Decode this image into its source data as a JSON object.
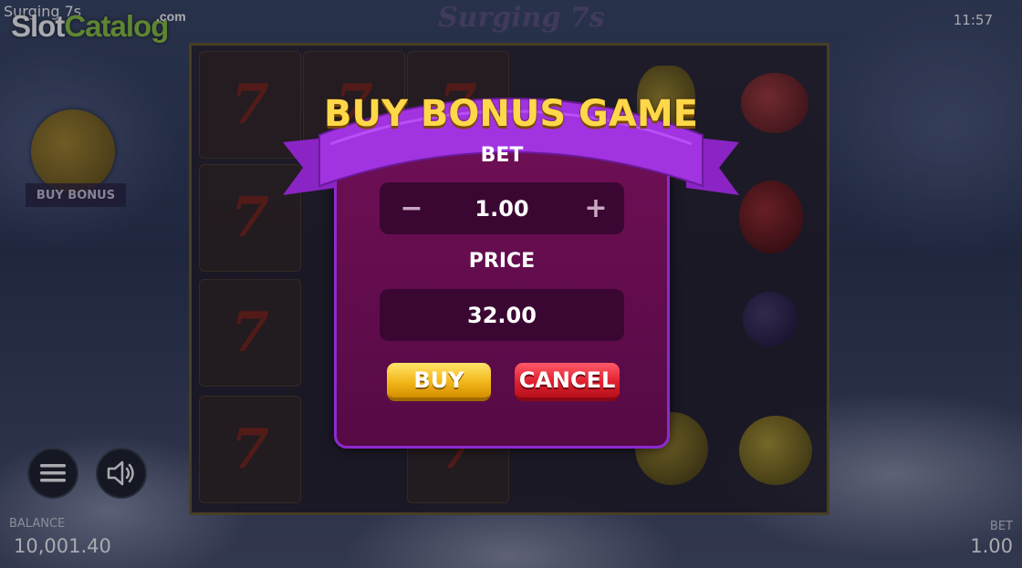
{
  "header": {
    "game_title": "Surging 7s",
    "clock": "11:57",
    "logo_part1": "Slot",
    "logo_part2": "Catalog",
    "logo_suffix": ".com",
    "background_title": "Surging 7s"
  },
  "side": {
    "buy_bonus_label": "BUY BONUS"
  },
  "reels": {
    "symbols": [
      "7",
      "7",
      "7",
      "7",
      "7",
      "7",
      "7"
    ]
  },
  "modal": {
    "title": "BUY BONUS GAME",
    "bet_label": "BET",
    "bet_value": "1.00",
    "minus_label": "−",
    "plus_label": "+",
    "price_label": "PRICE",
    "price_value": "32.00",
    "buy_label": "BUY",
    "cancel_label": "CANCEL"
  },
  "footer": {
    "balance_label": "BALANCE",
    "balance_value": "10,001.40",
    "bet_label": "BET",
    "bet_value": "1.00"
  },
  "icons": {
    "menu": "menu-icon",
    "sound": "speaker-icon",
    "coin": "coin-icon"
  },
  "colors": {
    "modal_bg": "#6e0f55",
    "ribbon": "#9a2fd0",
    "title_gold": "#ffd84a",
    "buy": "#f2b71a",
    "cancel": "#e0202e"
  }
}
